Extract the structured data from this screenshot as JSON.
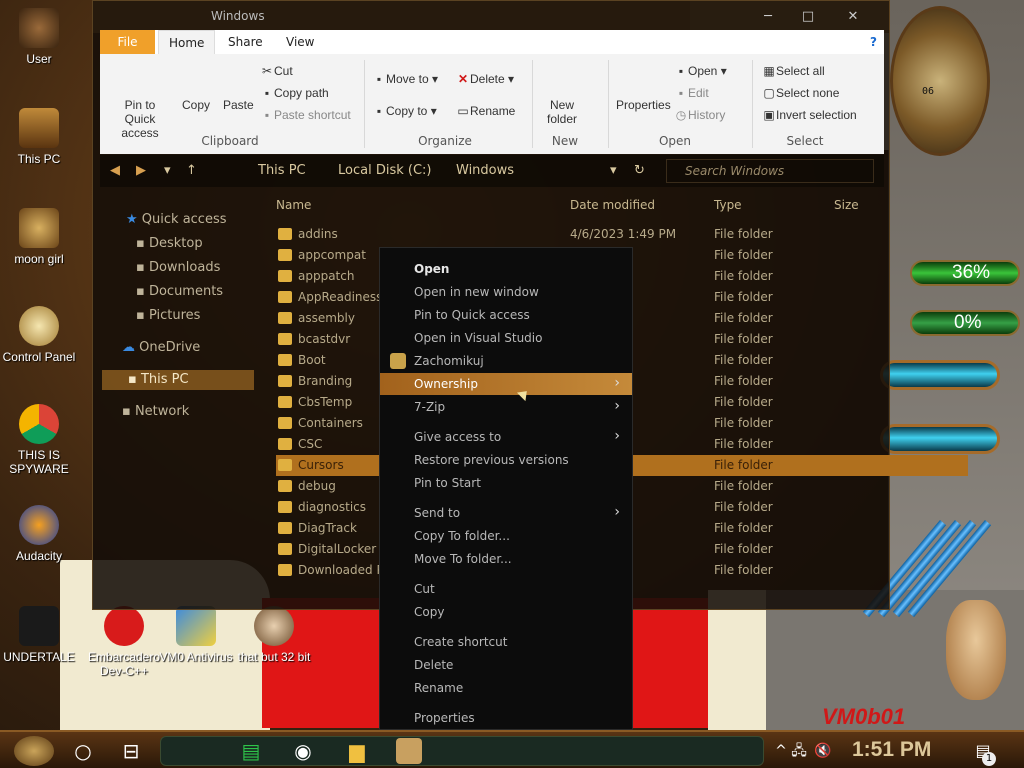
{
  "desktop_icons": [
    {
      "label": "User"
    },
    {
      "label": "This PC"
    },
    {
      "label": "moon girl"
    },
    {
      "label": "Control Panel"
    },
    {
      "label": "THIS IS SPYWARE"
    },
    {
      "label": "Audacity"
    },
    {
      "label": "UNDERTALE"
    },
    {
      "label": "Embarcadero Dev-C++"
    },
    {
      "label": "VM0 Antivirus"
    },
    {
      "label": "that but 32 bit"
    }
  ],
  "window": {
    "title": "Windows",
    "controls": {
      "minimize": "─",
      "maximize": "□",
      "close": "✕"
    }
  },
  "ribbon": {
    "tabs": [
      "File",
      "Home",
      "Share",
      "View"
    ],
    "active_tab": "Home",
    "clipboard": {
      "pin": "Pin to Quick access",
      "copy": "Copy",
      "paste": "Paste",
      "cut": "Cut",
      "copy_path": "Copy path",
      "paste_shortcut": "Paste shortcut",
      "group": "Clipboard"
    },
    "organize": {
      "move_to": "Move to",
      "copy_to": "Copy to",
      "delete": "Delete",
      "rename": "Rename",
      "group": "Organize"
    },
    "new": {
      "new_folder": "New folder",
      "group": "New"
    },
    "open": {
      "properties": "Properties",
      "open": "Open",
      "edit": "Edit",
      "history": "History",
      "group": "Open"
    },
    "select": {
      "select_all": "Select all",
      "select_none": "Select none",
      "invert": "Invert selection",
      "group": "Select"
    }
  },
  "address": {
    "crumbs": [
      "This PC",
      "Local Disk (C:)",
      "Windows"
    ],
    "search_placeholder": "Search Windows"
  },
  "nav_pane": {
    "items": [
      "Quick access",
      "Desktop",
      "Downloads",
      "Documents",
      "Pictures",
      "OneDrive",
      "This PC",
      "Network"
    ],
    "selected": "This PC"
  },
  "columns": {
    "name": "Name",
    "date": "Date modified",
    "type": "Type",
    "size": "Size"
  },
  "files": [
    {
      "name": "addins",
      "date": "4/6/2023 1:49 PM",
      "type": "File folder"
    },
    {
      "name": "appcompat",
      "date": "10:59 AM",
      "type": "File folder"
    },
    {
      "name": "apppatch",
      "date": ":59 PM",
      "type": "File folder"
    },
    {
      "name": "AppReadiness",
      "date": "11:03 AM",
      "type": "File folder"
    },
    {
      "name": "assembly",
      "date": "3:32 AM",
      "type": "File folder"
    },
    {
      "name": "bcastdvr",
      "date": ":31 AM",
      "type": "File folder"
    },
    {
      "name": "Boot",
      "date": ":31 AM",
      "type": "File folder"
    },
    {
      "name": "Branding",
      "date": ":14 AM",
      "type": "File folder"
    },
    {
      "name": "CbsTemp",
      "date": ":19 PM",
      "type": "File folder"
    },
    {
      "name": "Containers",
      "date": "0:41 AM",
      "type": "File folder"
    },
    {
      "name": "CSC",
      "date": "4:51 PM",
      "type": "File folder"
    },
    {
      "name": "Cursors",
      "date": ":14 AM",
      "type": "File folder"
    },
    {
      "name": "debug",
      "date": ":14 AM",
      "type": "File folder"
    },
    {
      "name": "diagnostics",
      "date": ":31 AM",
      "type": "File folder"
    },
    {
      "name": "DiagTrack",
      "date": "7:17 AM",
      "type": "File folder"
    },
    {
      "name": "DigitalLocker",
      "date": ":50 AM",
      "type": "File folder"
    },
    {
      "name": "Downloaded Pr",
      "date": ":14 AM",
      "type": "File folder"
    }
  ],
  "selected_file": "Cursors",
  "context_menu": {
    "items": [
      {
        "label": "Open",
        "bold": true
      },
      {
        "label": "Open in new window"
      },
      {
        "label": "Pin to Quick access"
      },
      {
        "label": "Open in Visual Studio"
      },
      {
        "label": "Zachomikuj",
        "icon": "archive-icon"
      },
      {
        "label": "Ownership",
        "submenu": true,
        "hot": true
      },
      {
        "label": "7-Zip",
        "submenu": true
      },
      {
        "label": "Give access to",
        "submenu": true
      },
      {
        "label": "Restore previous versions"
      },
      {
        "label": "Pin to Start"
      },
      {
        "label": "Send to",
        "submenu": true
      },
      {
        "label": "Copy To folder..."
      },
      {
        "label": "Move To folder..."
      },
      {
        "label": "Cut"
      },
      {
        "label": "Copy"
      },
      {
        "label": "Create shortcut"
      },
      {
        "label": "Delete"
      },
      {
        "label": "Rename"
      },
      {
        "label": "Properties"
      }
    ]
  },
  "gauges": {
    "top": "36%",
    "bottom": "0%"
  },
  "taskbar": {
    "time": "1:51 PM",
    "notification_count": "1"
  },
  "wallpaper_text": "VM0b01",
  "colors": {
    "accent": "#b0701e",
    "ribbon_file": "#f0a02a",
    "taskbar": "#5a3414"
  }
}
